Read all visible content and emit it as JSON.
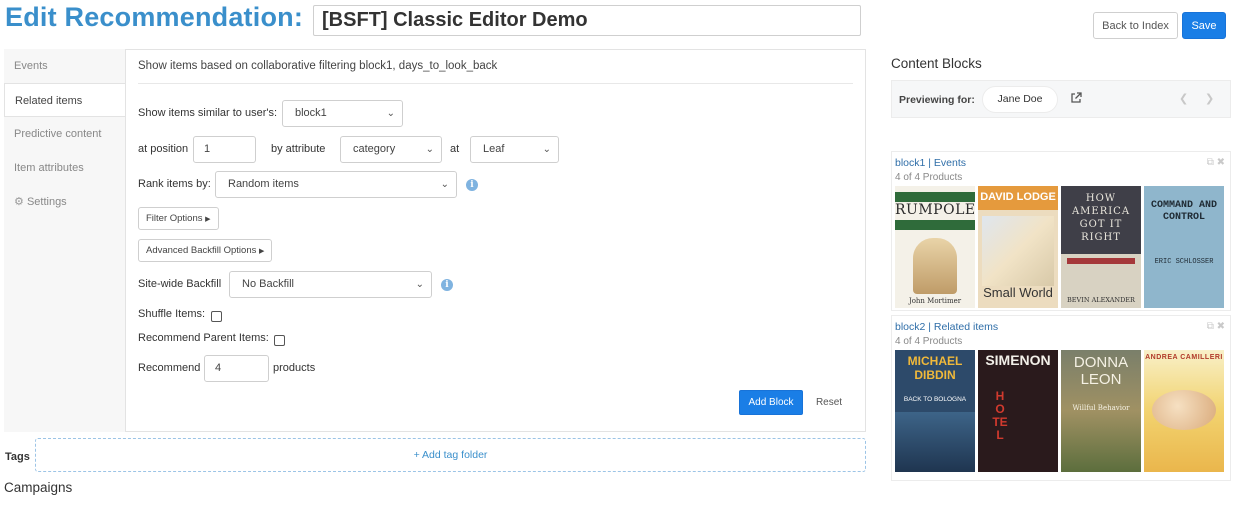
{
  "header": {
    "title": "Edit Recommendation:",
    "name_value": "[BSFT] Classic Editor Demo",
    "back_label": "Back to Index",
    "save_label": "Save"
  },
  "tabs": [
    {
      "label": "Events"
    },
    {
      "label": "Related items"
    },
    {
      "label": "Predictive content"
    },
    {
      "label": "Item attributes"
    },
    {
      "label": "Settings",
      "icon": "gear-icon"
    }
  ],
  "form": {
    "description": "Show items based on collaborative filtering block1, days_to_look_back",
    "similar_label": "Show items similar to user's:",
    "similar_value": "block1",
    "position_label": "at position",
    "position_value": "1",
    "attribute_label": "by attribute",
    "attribute_value": "category",
    "at_label": "at",
    "level_value": "Leaf",
    "rank_label": "Rank items by:",
    "rank_value": "Random items",
    "filter_options_label": "Filter Options",
    "advanced_backfill_label": "Advanced Backfill Options",
    "backfill_label": "Site-wide Backfill",
    "backfill_value": "No Backfill",
    "shuffle_label": "Shuffle Items:",
    "parent_label": "Recommend Parent Items:",
    "recommend_label": "Recommend",
    "recommend_value": "4",
    "products_label": "products",
    "add_block_label": "Add Block",
    "reset_label": "Reset"
  },
  "tags": {
    "label": "Tags",
    "add_folder_label": "+ Add tag folder"
  },
  "campaigns_label": "Campaigns",
  "content_blocks": {
    "title": "Content Blocks",
    "previewing_label": "Previewing for:",
    "preview_user": "Jane Doe",
    "blocks": [
      {
        "title": "block1 | Events",
        "count": "4 of 4 Products",
        "books": [
          {
            "title": "RUMPOLE",
            "sub": "John Mortimer"
          },
          {
            "title": "DAVID LODGE",
            "sub": "Small World"
          },
          {
            "title": "HOW AMERICA GOT IT RIGHT",
            "sub": "BEVIN ALEXANDER"
          },
          {
            "title": "COMMAND AND CONTROL",
            "sub": "ERIC SCHLOSSER"
          }
        ]
      },
      {
        "title": "block2 | Related items",
        "count": "4 of 4 Products",
        "books": [
          {
            "title": "MICHAEL DIBDIN",
            "sub": "BACK TO BOLOGNA"
          },
          {
            "title": "SIMENON",
            "sub": "HOTEL"
          },
          {
            "title": "DONNA LEON",
            "sub": "Willful Behavior"
          },
          {
            "title": "ANDREA CAMILLERI",
            "sub": ""
          }
        ]
      }
    ]
  }
}
